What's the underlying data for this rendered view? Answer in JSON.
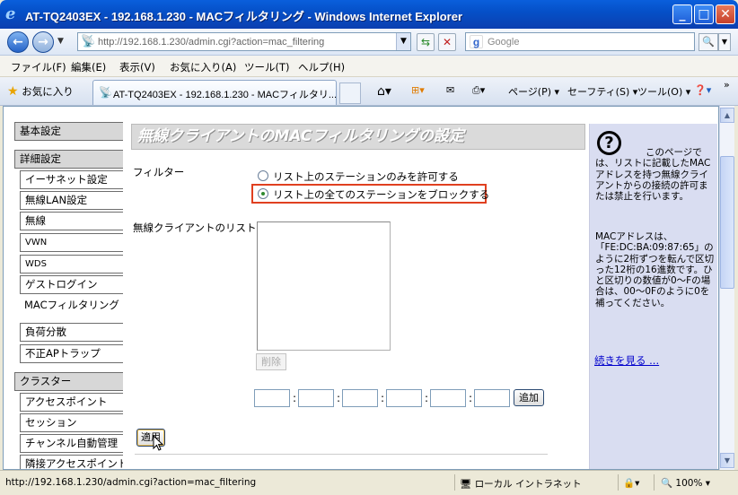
{
  "window": {
    "title": "AT-TQ2403EX - 192.168.1.230 - MACフィルタリング - Windows Internet Explorer",
    "minimize": "_",
    "maximize": "□",
    "close": "✕"
  },
  "address": {
    "url": "http://192.168.1.230/admin.cgi?action=mac_filtering",
    "search_placeholder": "Google"
  },
  "menu": [
    "ファイル(F)",
    "編集(E)",
    "表示(V)",
    "お気に入り(A)",
    "ツール(T)",
    "ヘルプ(H)"
  ],
  "tabs": {
    "favorites": "お気に入り",
    "active_tab": "AT-TQ2403EX - 192.168.1.230 - MACフィルタリ...",
    "page": "ページ(P)",
    "safety": "セーフティ(S)",
    "tools": "ツール(O)"
  },
  "sidebar": {
    "basic": "基本設定",
    "advanced": "詳細設定",
    "items": [
      "イーサネット設定",
      "無線LAN設定",
      "無線",
      "VWN",
      "WDS",
      "ゲストログイン",
      "MACフィルタリング",
      "負荷分散",
      "不正APトラップ"
    ],
    "cluster": "クラスター",
    "cluster_items": [
      "アクセスポイント",
      "セッション",
      "チャンネル自動管理",
      "隣接アクセスポイント"
    ]
  },
  "main": {
    "title": "無線クライアントのMACフィルタリングの設定",
    "filter_label": "フィルター",
    "option_allow": "リスト上のステーションのみを許可する",
    "option_block": "リスト上の全てのステーションをブロックする",
    "selected_option": "block",
    "list_label": "無線クライアントのリスト",
    "delete_button": "削除",
    "mac_separator": ":",
    "add_button": "追加",
    "apply_button": "適用"
  },
  "help": {
    "icon": "?",
    "para1": "このページでは、リストに記載したMACアドレスを持つ無線クライアントからの接続の許可または禁止を行います。",
    "para2": "MACアドレスは、「FE:DC:BA:09:87:65」のように2桁ずつを転んで区切った12桁の16進数です。ひと区切りの数値が0〜Fの場合は、00〜0Fのように0を補ってください。",
    "more_link": "続きを見る ..."
  },
  "status": {
    "url": "http://192.168.1.230/admin.cgi?action=mac_filtering",
    "zone": "ローカル イントラネット",
    "zoom": "100%"
  },
  "colors": {
    "highlight_border": "#e04020",
    "help_bg": "#d9ddf1",
    "title_bar": "#0550c8"
  }
}
